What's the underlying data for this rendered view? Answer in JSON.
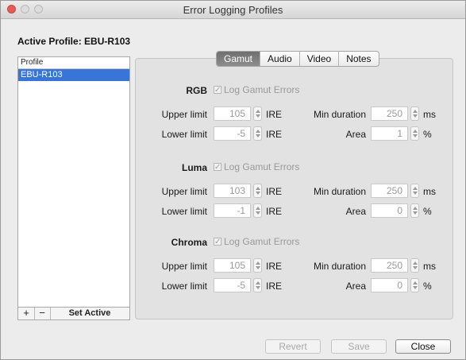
{
  "window": {
    "title": "Error Logging Profiles"
  },
  "active_profile_label": "Active Profile: EBU-R103",
  "profile_list": {
    "header": "Profile",
    "items": [
      "EBU-R103"
    ],
    "selected": "EBU-R103",
    "add_label": "+",
    "remove_label": "−",
    "set_active_label": "Set Active"
  },
  "tabs": [
    {
      "label": "Gamut",
      "active": true
    },
    {
      "label": "Audio",
      "active": false
    },
    {
      "label": "Video",
      "active": false
    },
    {
      "label": "Notes",
      "active": false
    }
  ],
  "sections": [
    {
      "title": "RGB",
      "checkbox_label": "Log Gamut Errors",
      "checked": true,
      "upper_limit_label": "Upper limit",
      "upper_limit": "105",
      "upper_unit": "IRE",
      "lower_limit_label": "Lower limit",
      "lower_limit": "-5",
      "lower_unit": "IRE",
      "min_duration_label": "Min duration",
      "min_duration": "250",
      "duration_unit": "ms",
      "area_label": "Area",
      "area": "1",
      "area_unit": "%"
    },
    {
      "title": "Luma",
      "checkbox_label": "Log Gamut Errors",
      "checked": true,
      "upper_limit_label": "Upper limit",
      "upper_limit": "103",
      "upper_unit": "IRE",
      "lower_limit_label": "Lower limit",
      "lower_limit": "-1",
      "lower_unit": "IRE",
      "min_duration_label": "Min duration",
      "min_duration": "250",
      "duration_unit": "ms",
      "area_label": "Area",
      "area": "0",
      "area_unit": "%"
    },
    {
      "title": "Chroma",
      "checkbox_label": "Log Gamut Errors",
      "checked": true,
      "upper_limit_label": "Upper limit",
      "upper_limit": "105",
      "upper_unit": "IRE",
      "lower_limit_label": "Lower limit",
      "lower_limit": "-5",
      "lower_unit": "IRE",
      "min_duration_label": "Min duration",
      "min_duration": "250",
      "duration_unit": "ms",
      "area_label": "Area",
      "area": "0",
      "area_unit": "%"
    }
  ],
  "buttons": {
    "revert": "Revert",
    "save": "Save",
    "close": "Close"
  },
  "colors": {
    "selection": "#3875d7",
    "close_light": "#e45c55",
    "active_tab": "#7a7a7a"
  }
}
